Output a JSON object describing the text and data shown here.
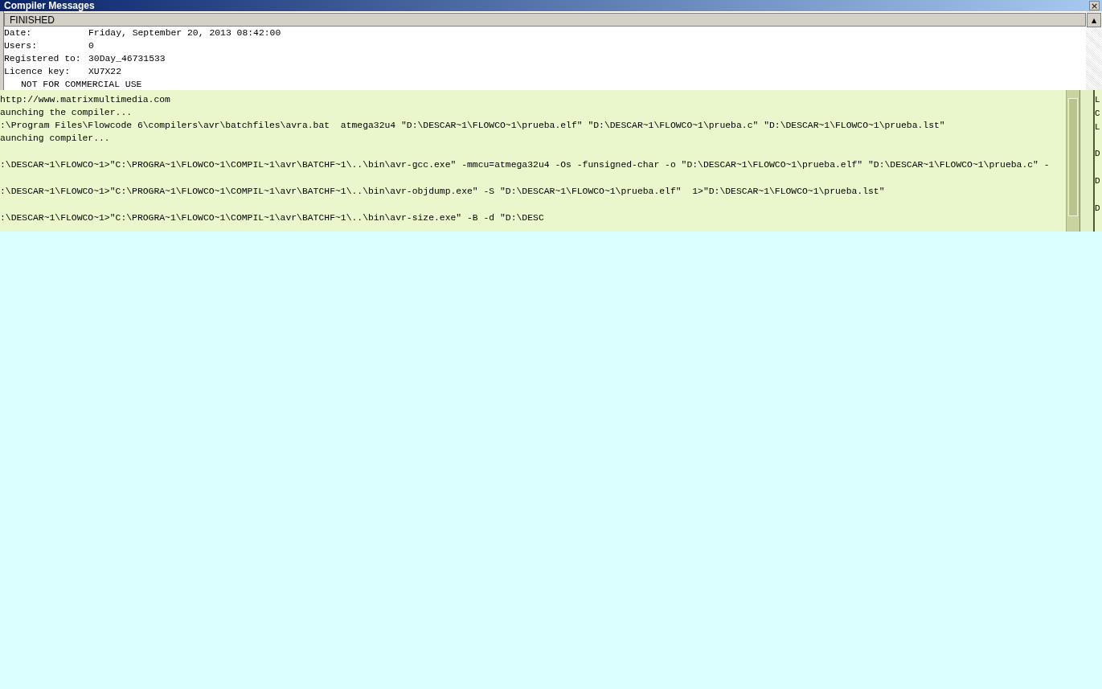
{
  "window": {
    "title": "Compiler Messages",
    "close": "×"
  },
  "status": {
    "label": "FINISHED",
    "scroll_up": "▲"
  },
  "info_rows": [
    {
      "label": "Date:",
      "value": "Friday, September 20, 2013 08:42:00"
    },
    {
      "label": "Users:",
      "value": "0"
    },
    {
      "label": "Registered to:",
      "value": "30Day_46731533"
    },
    {
      "label": "Licence key:",
      "value": "XU7X22"
    }
  ],
  "notice": "NOT FOR COMMERCIAL USE",
  "log_blocks": [
    {
      "lines": [
        "http://www.matrixmultimedia.com",
        "aunching the compiler...",
        ":\\Program Files\\Flowcode 6\\compilers\\avr\\batchfiles\\avra.bat  atmega32u4 \"D:\\DESCAR~1\\FLOWCO~1\\prueba.elf\" \"D:\\DESCAR~1\\FLOWCO~1\\prueba.c\" \"D:\\DESCAR~1\\FLOWCO~1\\prueba.lst\"",
        "aunching compiler..."
      ]
    },
    {
      "lines": [
        ":\\DESCAR~1\\FLOWCO~1>\"C:\\PROGRA~1\\FLOWCO~1\\COMPIL~1\\avr\\BATCHF~1\\..\\bin\\avr-gcc.exe\" -mmcu=atmega32u4 -Os -funsigned-char -o \"D:\\DESCAR~1\\FLOWCO~1\\prueba.elf\" \"D:\\DESCAR~1\\FLOWCO~1\\prueba.c\" -"
      ]
    },
    {
      "lines": [
        ":\\DESCAR~1\\FLOWCO~1>\"C:\\PROGRA~1\\FLOWCO~1\\COMPIL~1\\avr\\BATCHF~1\\..\\bin\\avr-objdump.exe\" -S \"D:\\DESCAR~1\\FLOWCO~1\\prueba.elf\"  1>\"D:\\DESCAR~1\\FLOWCO~1\\prueba.lst\""
      ]
    },
    {
      "lines": [
        ":\\DESCAR~1\\FLOWCO~1>\"C:\\PROGRA~1\\FLOWCO~1\\COMPIL~1\\avr\\BATCHF~1\\..\\bin\\avr-size.exe\" -B -d \"D:\\DESC"
      ]
    }
  ],
  "side_column": [
    "L",
    "C",
    "L",
    "D",
    "D",
    "D"
  ]
}
